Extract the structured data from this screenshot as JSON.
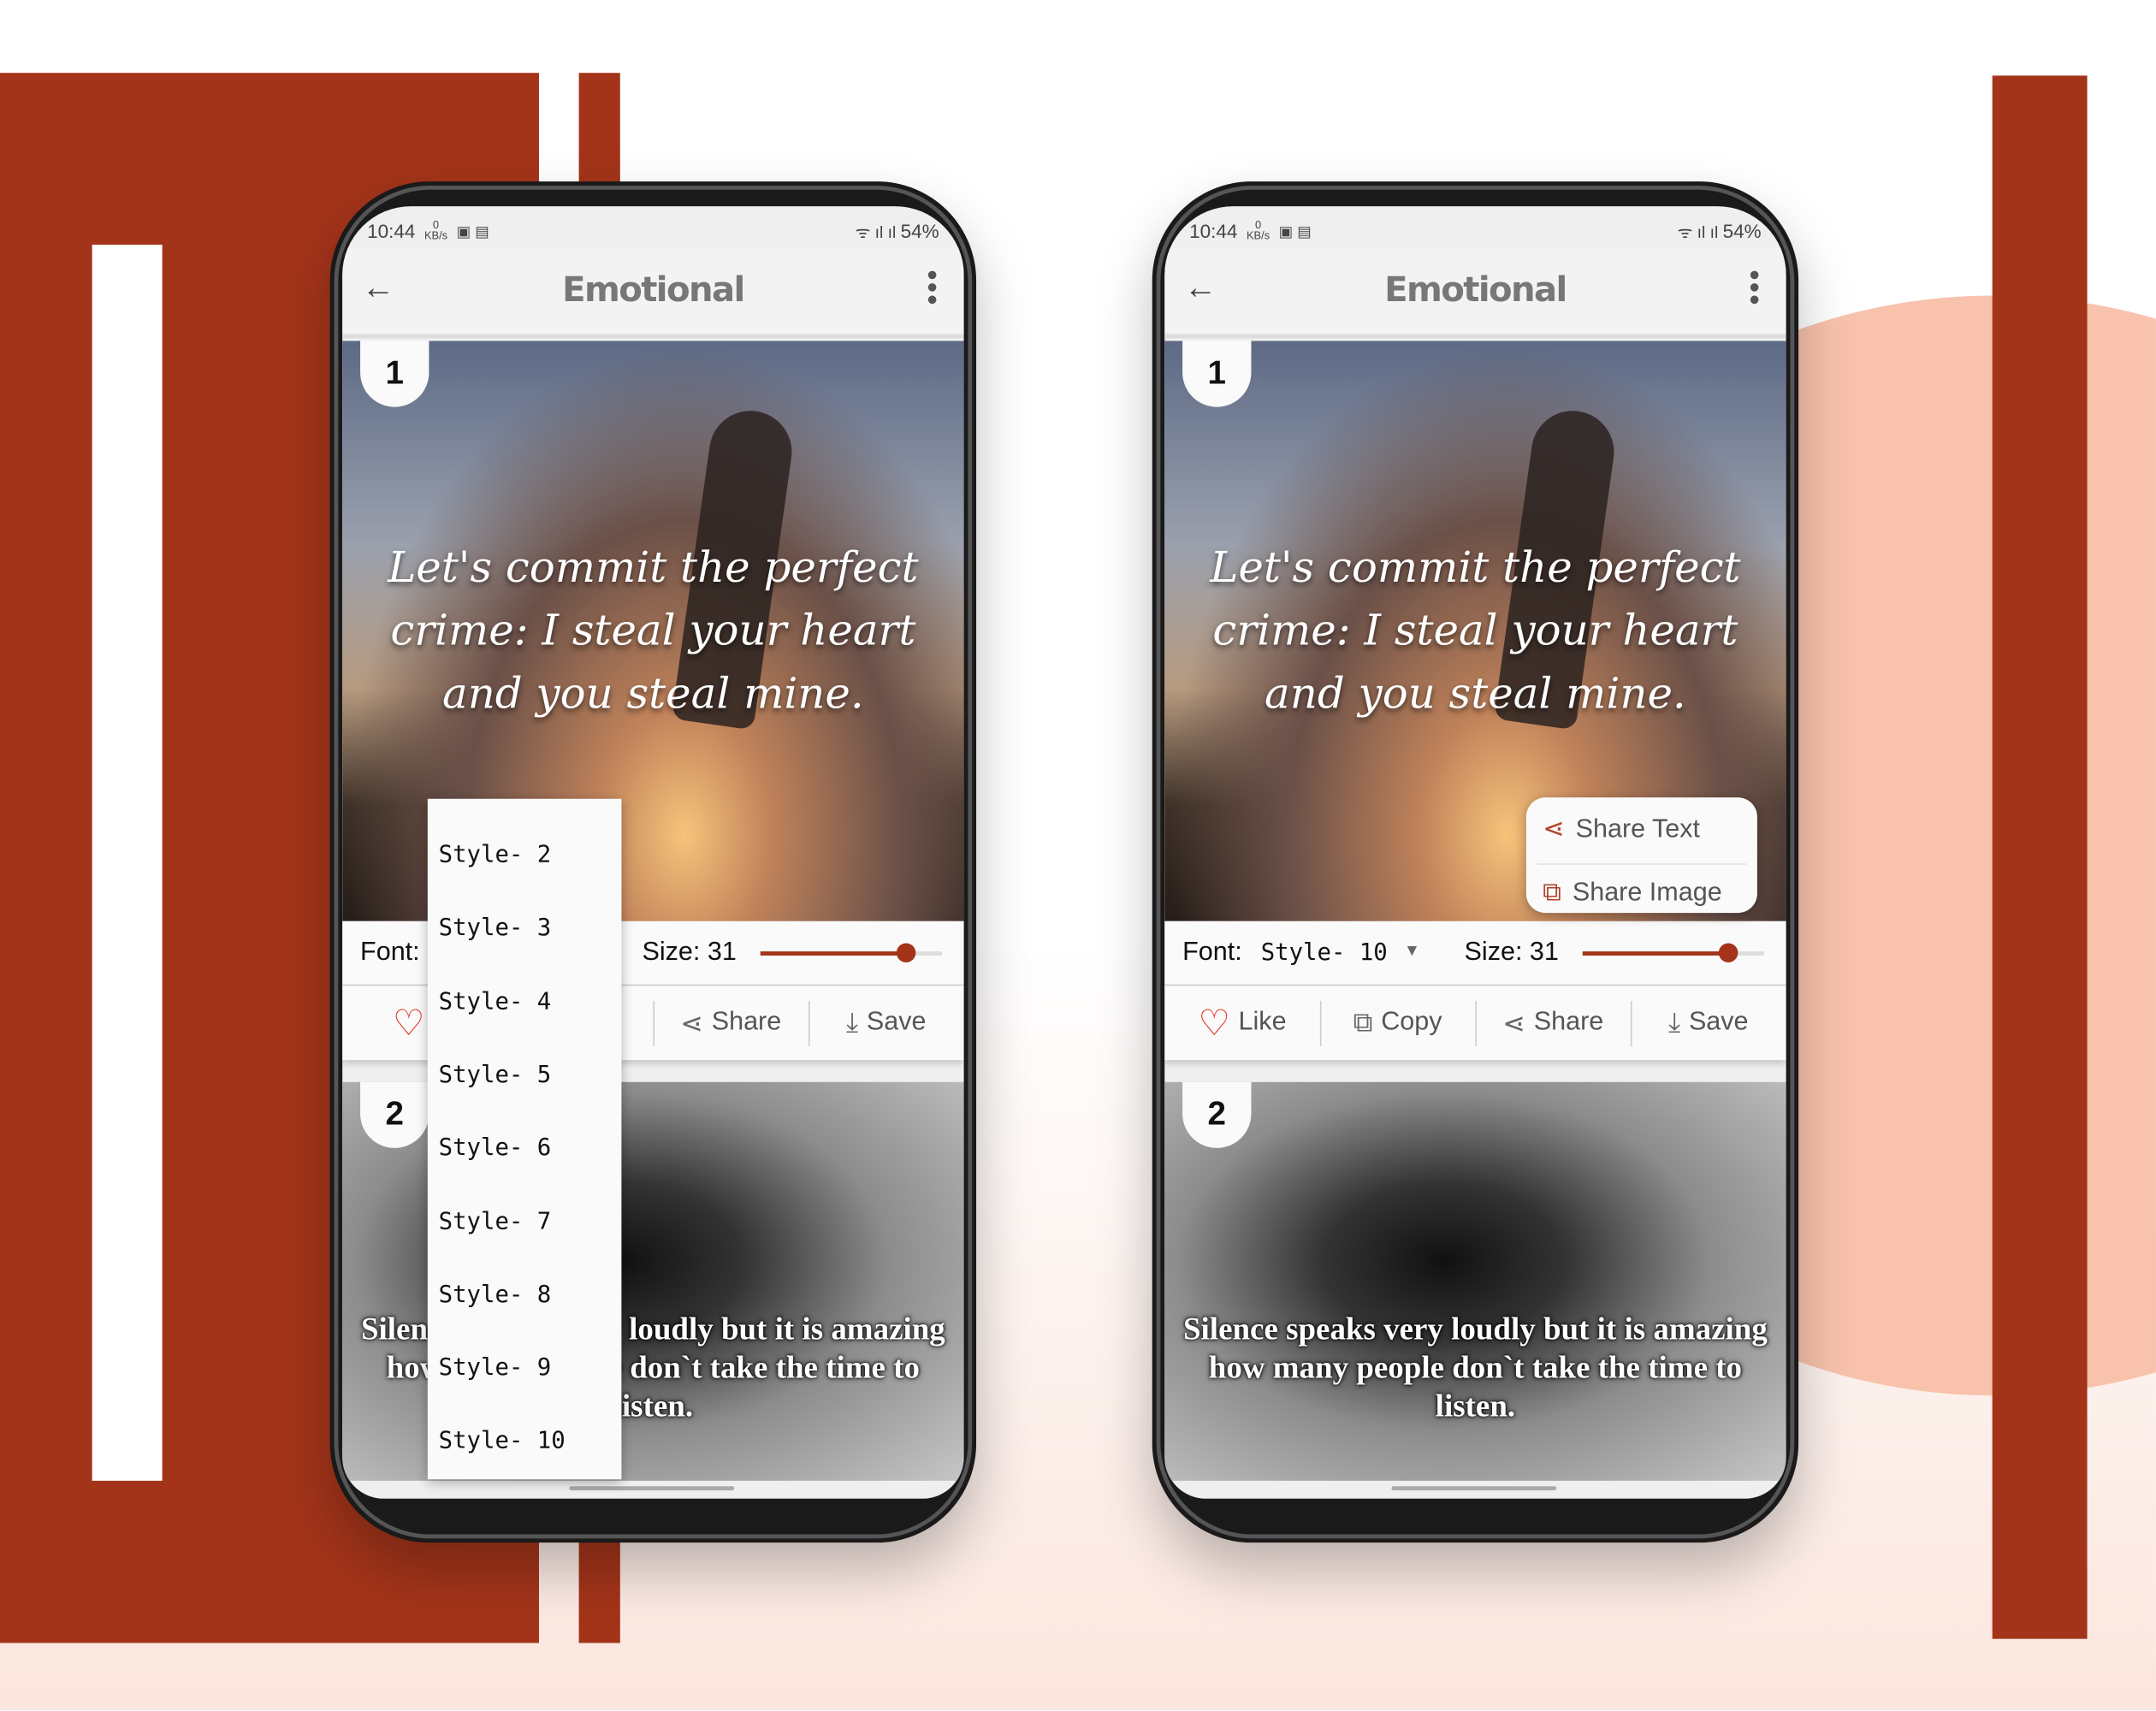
{
  "colors": {
    "brand_red": "#a3341a",
    "peach": "#f9c2ac",
    "accent": "#b2432a",
    "like": "#e0301e"
  },
  "phones": [
    {
      "status": {
        "time": "10:44",
        "speed": "0 KB/s",
        "battery": "54%"
      },
      "appbar": {
        "back_icon": "arrow-left-icon",
        "title": "Emotional",
        "menu_icon": "more-vert-icon"
      },
      "card1": {
        "number": "1",
        "quote": "Let's commit the perfect crime: I steal your heart and you steal mine."
      },
      "controls": {
        "font_label": "Font:",
        "font_value": "",
        "size_label": "Size: 31",
        "size_value": 31,
        "size_fraction": 0.8
      },
      "actions": {
        "like": "L",
        "copy": "",
        "share": "Share",
        "save": "Save"
      },
      "card2": {
        "number": "2",
        "quote": "Silence speaks very loudly but it is amazing how many people don`t take the time to listen."
      },
      "dropdown": [
        "Style- 2",
        "Style- 3",
        "Style- 4",
        "Style- 5",
        "Style- 6",
        "Style- 7",
        "Style- 8",
        "Style- 9",
        "Style- 10"
      ]
    },
    {
      "status": {
        "time": "10:44",
        "speed": "0 KB/s",
        "battery": "54%"
      },
      "appbar": {
        "back_icon": "arrow-left-icon",
        "title": "Emotional",
        "menu_icon": "more-vert-icon"
      },
      "card1": {
        "number": "1",
        "quote": "Let's commit the perfect crime: I steal your heart and you steal mine."
      },
      "controls": {
        "font_label": "Font:",
        "font_value": "Style- 10",
        "size_label": "Size: 31",
        "size_value": 31,
        "size_fraction": 0.8
      },
      "actions": {
        "like": "Like",
        "copy": "Copy",
        "share": "Share",
        "save": "Save"
      },
      "card2": {
        "number": "2",
        "quote": "Silence speaks very loudly but it is amazing how many people don`t take the time to listen."
      },
      "popup": {
        "share_text": "Share Text",
        "share_image": "Share Image"
      }
    }
  ]
}
